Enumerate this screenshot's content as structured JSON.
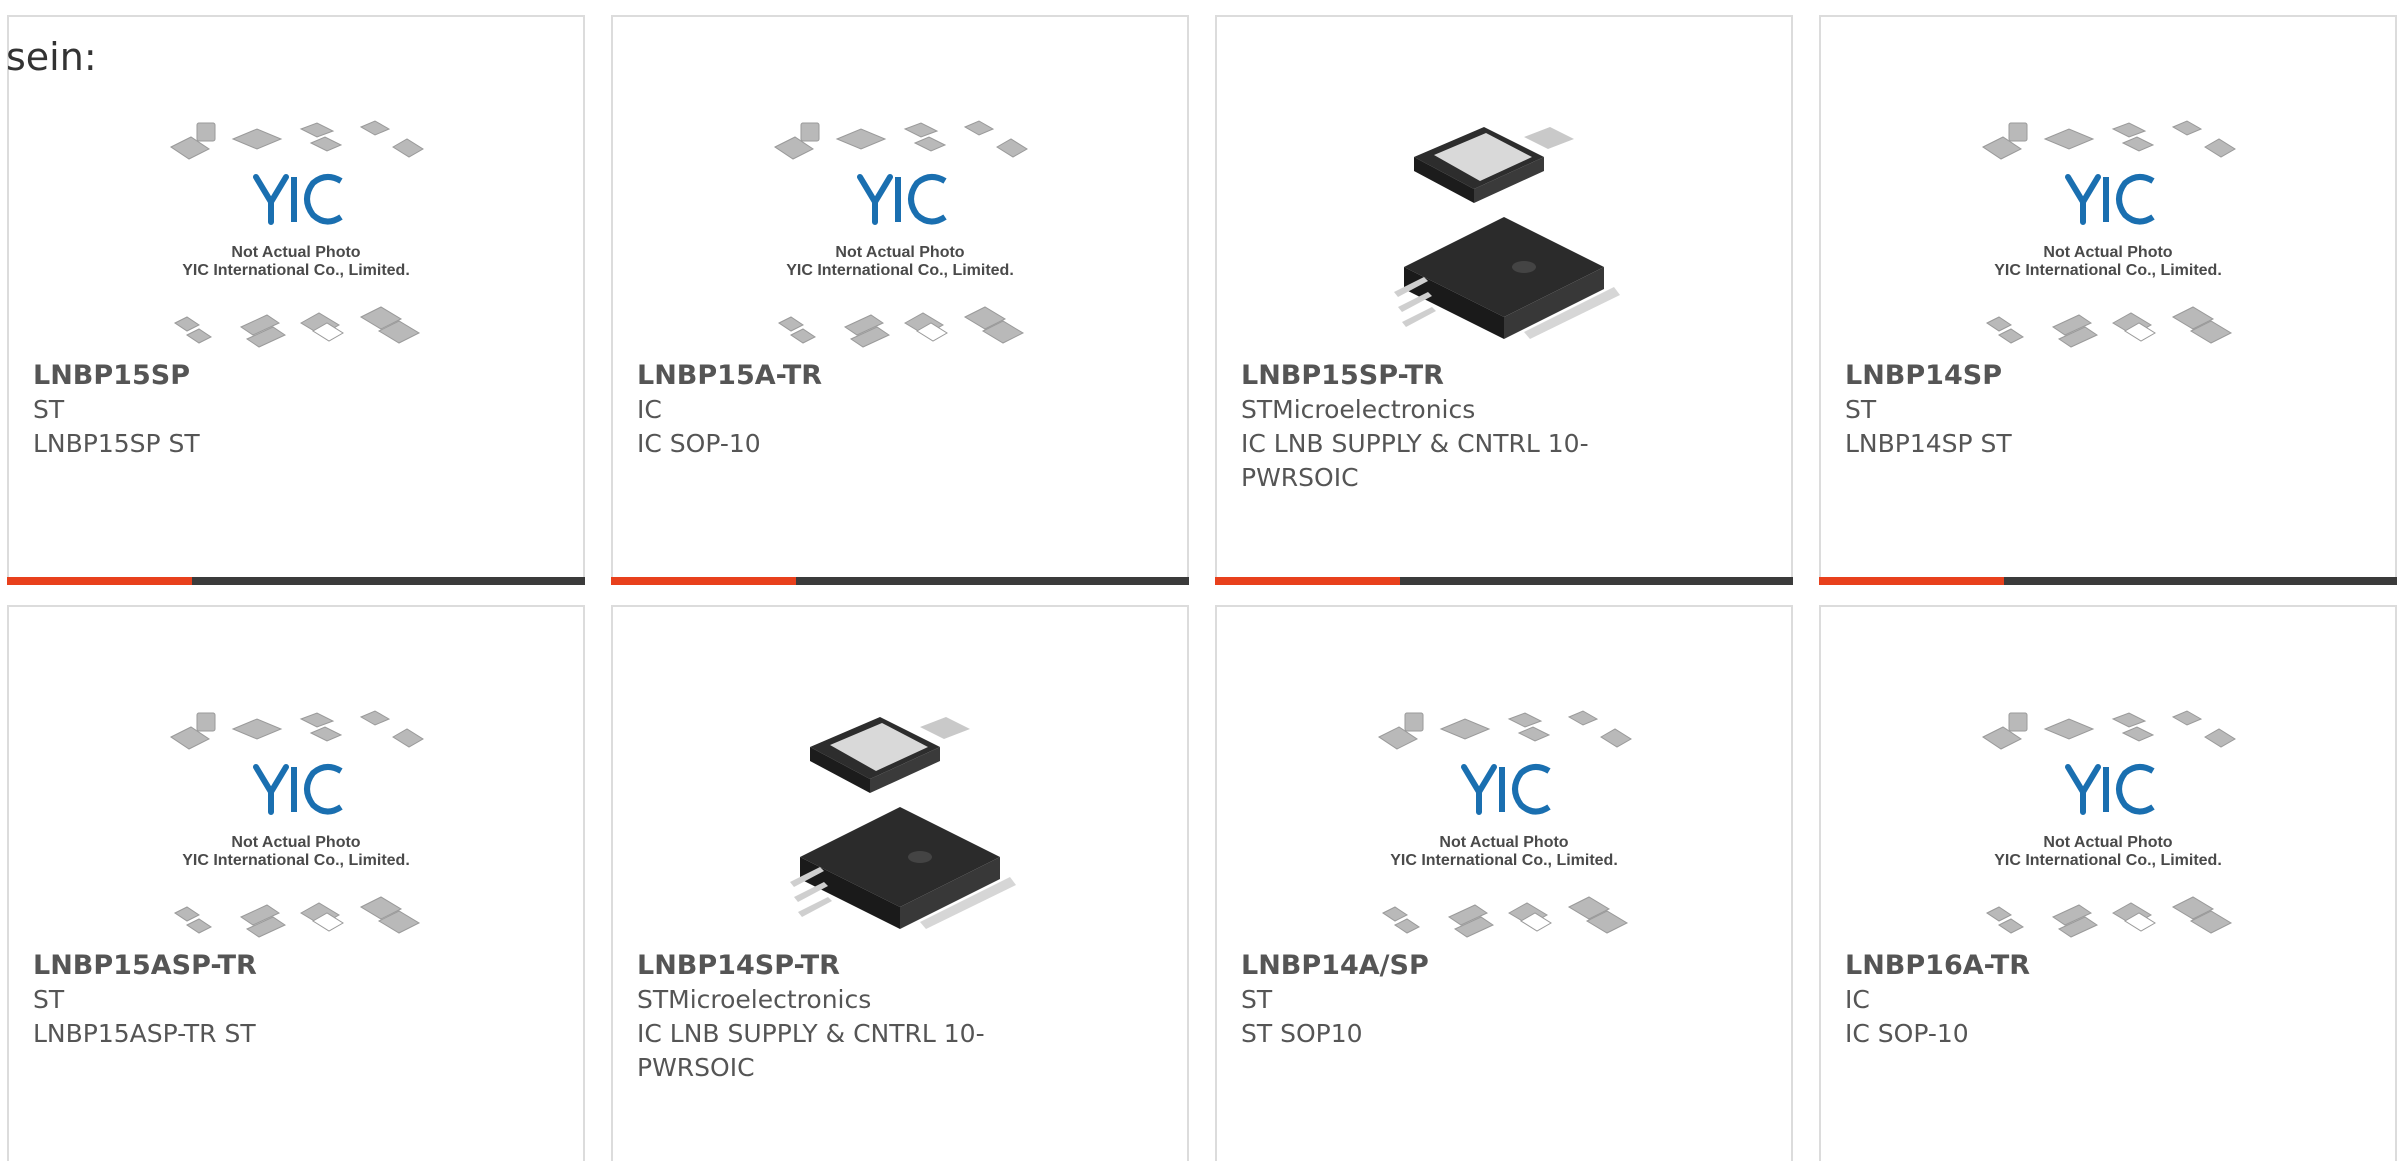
{
  "intro_text": "sein:",
  "colors": {
    "accent": "#e8401c",
    "bar_track": "#3b3b3b",
    "logo_blue": "#1a6fb0"
  },
  "placeholder_caption": {
    "line1": "Not Actual Photo",
    "line2": "YIC International Co., Limited."
  },
  "products": [
    {
      "part": "LNBP15SP",
      "brand": "ST",
      "desc": "LNBP15SP ST",
      "image": "placeholder",
      "progress": 0.32
    },
    {
      "part": "LNBP15A-TR",
      "brand": "IC",
      "desc": "IC SOP-10",
      "image": "placeholder",
      "progress": 0.32
    },
    {
      "part": "LNBP15SP-TR",
      "brand": "STMicroelectronics",
      "desc": "IC LNB SUPPLY & CNTRL 10-PWRSOIC",
      "image": "chip",
      "progress": 0.32
    },
    {
      "part": "LNBP14SP",
      "brand": "ST",
      "desc": "LNBP14SP ST",
      "image": "placeholder",
      "progress": 0.32
    },
    {
      "part": "LNBP15ASP-TR",
      "brand": "ST",
      "desc": "LNBP15ASP-TR ST",
      "image": "placeholder",
      "progress": 0
    },
    {
      "part": "LNBP14SP-TR",
      "brand": "STMicroelectronics",
      "desc": "IC LNB SUPPLY & CNTRL 10-PWRSOIC",
      "image": "chip",
      "progress": 0
    },
    {
      "part": "LNBP14A/SP",
      "brand": "ST",
      "desc": "ST SOP10",
      "image": "placeholder",
      "progress": 0
    },
    {
      "part": "LNBP16A-TR",
      "brand": "IC",
      "desc": "IC SOP-10",
      "image": "placeholder",
      "progress": 0
    }
  ]
}
